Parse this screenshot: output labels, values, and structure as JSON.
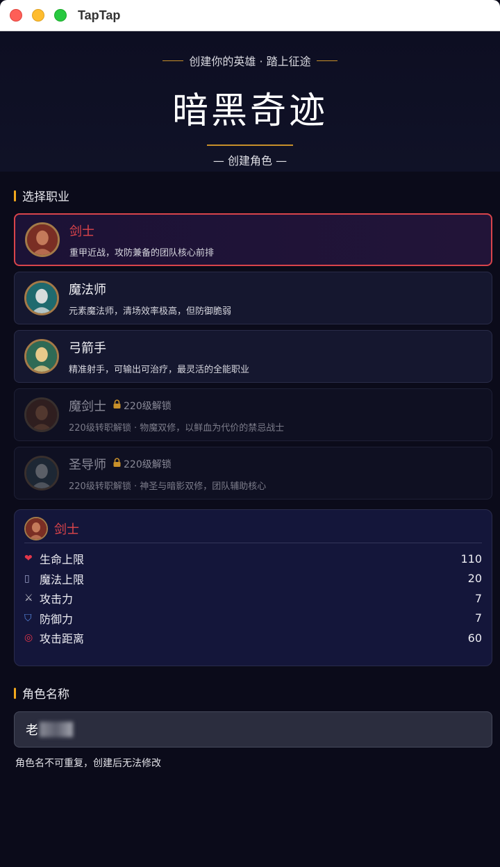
{
  "window": {
    "title": "TapTap"
  },
  "header": {
    "tagline": "创建你的英雄 · 踏上征途",
    "title": "暗黑奇迹",
    "subtitle": "— 创建角色 —"
  },
  "class_section": {
    "title": "选择职业"
  },
  "classes": [
    {
      "name": "剑士",
      "desc": "重甲近战，攻防兼备的团队核心前排",
      "selected": true,
      "locked": false,
      "avatar_colors": [
        "#7a2e24",
        "#c47a5a"
      ]
    },
    {
      "name": "魔法师",
      "desc": "元素魔法师，清场效率极高，但防御脆弱",
      "selected": false,
      "locked": false,
      "avatar_colors": [
        "#1f6a6e",
        "#d8dcdc"
      ]
    },
    {
      "name": "弓箭手",
      "desc": "精准射手，可输出可治疗，最灵活的全能职业",
      "selected": false,
      "locked": false,
      "avatar_colors": [
        "#2f6a55",
        "#e8c98a"
      ]
    },
    {
      "name": "魔剑士",
      "desc": "220级转职解锁 · 物魔双修，以鲜血为代价的禁忌战士",
      "selected": false,
      "locked": true,
      "lock_text": "220级解锁",
      "avatar_colors": [
        "#4a2a1e",
        "#8a5a3a"
      ]
    },
    {
      "name": "圣导师",
      "desc": "220级转职解锁 · 神圣与暗影双修，团队辅助核心",
      "selected": false,
      "locked": true,
      "lock_text": "220级解锁",
      "avatar_colors": [
        "#2a3a44",
        "#9aa0a0"
      ]
    }
  ],
  "stats": {
    "class_name": "剑士",
    "rows": [
      {
        "icon": "❤",
        "icon_name": "heart-icon",
        "icon_color": "#e2364a",
        "label": "生命上限",
        "value": "110"
      },
      {
        "icon": "▯",
        "icon_name": "mana-icon",
        "icon_color": "#9aa0c8",
        "label": "魔法上限",
        "value": "20"
      },
      {
        "icon": "⚔",
        "icon_name": "crossed-swords-icon",
        "icon_color": "#c8c8d0",
        "label": "攻击力",
        "value": "7"
      },
      {
        "icon": "⛉",
        "icon_name": "shield-icon",
        "icon_color": "#5a8ee8",
        "label": "防御力",
        "value": "7"
      },
      {
        "icon": "◎",
        "icon_name": "target-icon",
        "icon_color": "#e2364a",
        "label": "攻击距离",
        "value": "60"
      }
    ]
  },
  "name_section": {
    "title": "角色名称",
    "input_value": "老",
    "hint": "角色名不可重复，创建后无法修改"
  },
  "colors": {
    "accent": "#f2a81d",
    "selected": "#d9444b",
    "background": "#0b0b1a"
  }
}
